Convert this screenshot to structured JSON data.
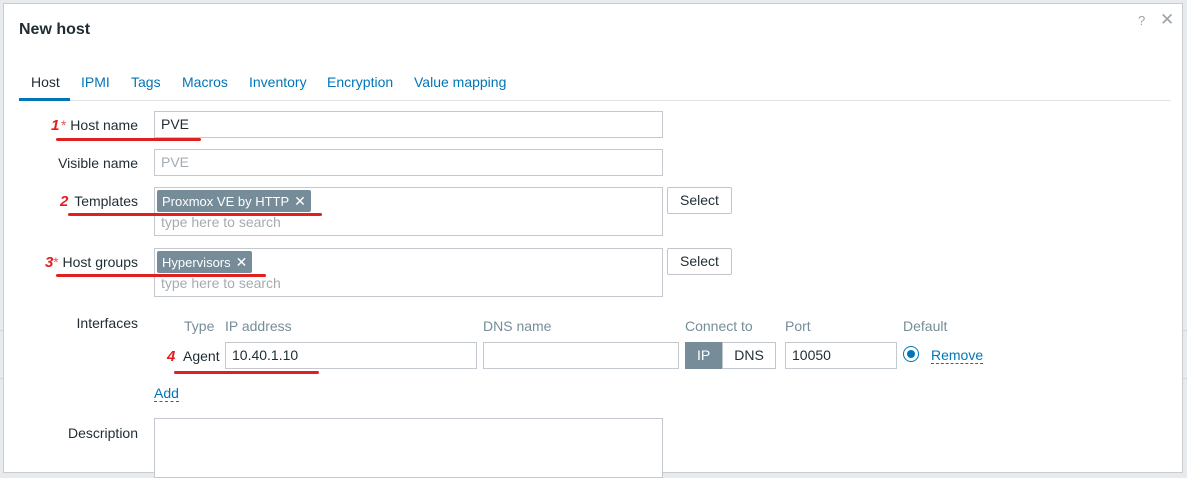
{
  "dialog": {
    "title": "New host",
    "help_symbol": "?",
    "close_symbol": "✕"
  },
  "tabs": [
    {
      "label": "Host",
      "active": true
    },
    {
      "label": "IPMI"
    },
    {
      "label": "Tags"
    },
    {
      "label": "Macros"
    },
    {
      "label": "Inventory"
    },
    {
      "label": "Encryption"
    },
    {
      "label": "Value mapping"
    }
  ],
  "form": {
    "host_name": {
      "marker": "1",
      "required": "*",
      "label": "Host name",
      "value": "PVE"
    },
    "visible_name": {
      "label": "Visible name",
      "placeholder": "PVE"
    },
    "templates": {
      "marker": "2",
      "label": "Templates",
      "chips": [
        {
          "label": "Proxmox VE by HTTP",
          "remove": "✕"
        }
      ],
      "placeholder": "type here to search",
      "select_label": "Select"
    },
    "host_groups": {
      "marker": "3",
      "required": "*",
      "label": "Host groups",
      "chips": [
        {
          "label": "Hypervisors",
          "remove": "✕"
        }
      ],
      "placeholder": "type here to search",
      "select_label": "Select"
    },
    "interfaces": {
      "label": "Interfaces",
      "headers": {
        "type": "Type",
        "ip": "IP address",
        "dns": "DNS name",
        "connect": "Connect to",
        "port": "Port",
        "default": "Default"
      },
      "rows": [
        {
          "marker": "4",
          "type": "Agent",
          "ip": "10.40.1.10",
          "dns": "",
          "connect_options": [
            "IP",
            "DNS"
          ],
          "connect_selected": "IP",
          "port": "10050",
          "remove_label": "Remove"
        }
      ],
      "add_label": "Add"
    },
    "description": {
      "label": "Description",
      "value": ""
    }
  },
  "colors": {
    "accent": "#0275b8",
    "chip": "#768d99",
    "annotation": "#e02020",
    "required": "#e45959"
  }
}
